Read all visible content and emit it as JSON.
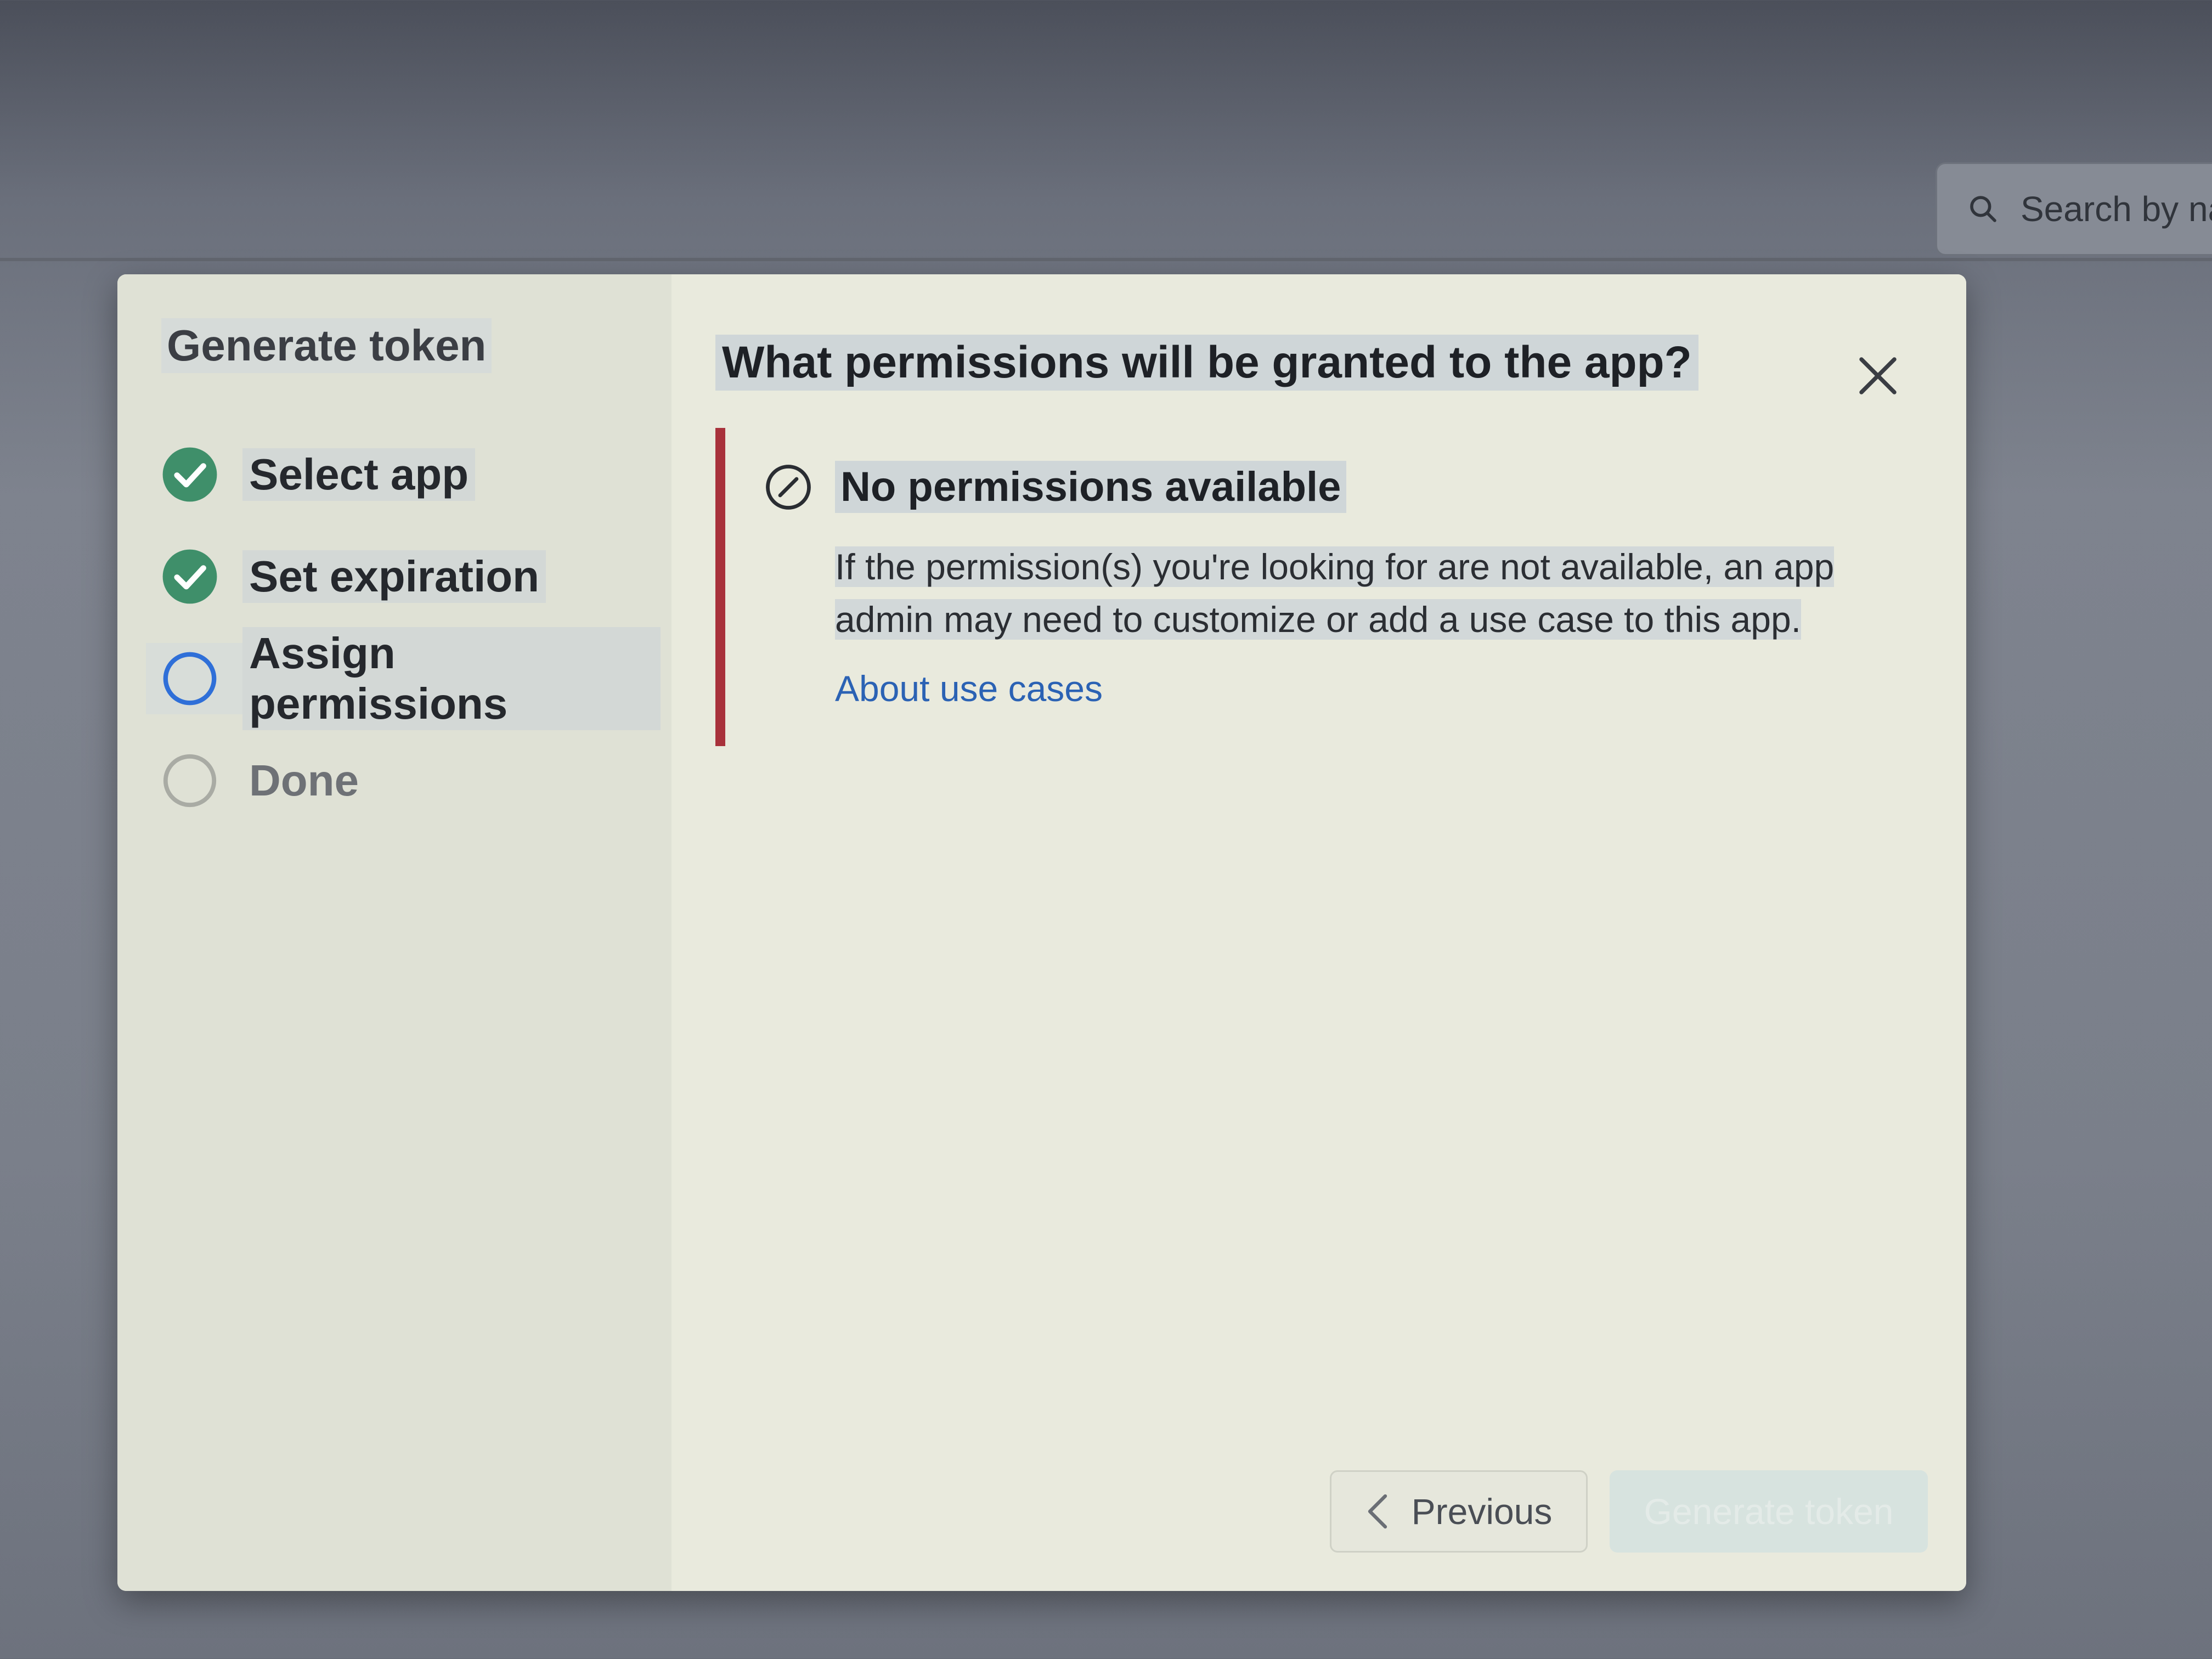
{
  "background": {
    "search_placeholder": "Search by na"
  },
  "modal": {
    "sidebar": {
      "title": "Generate token",
      "steps": [
        {
          "label": "Select app",
          "state": "complete"
        },
        {
          "label": "Set expiration",
          "state": "complete"
        },
        {
          "label": "Assign permissions",
          "state": "current"
        },
        {
          "label": "Done",
          "state": "pending"
        }
      ]
    },
    "main": {
      "title": "What permissions will be granted to the app?",
      "notice": {
        "heading": "No permissions available",
        "body": "If the permission(s) you're looking for are not available, an app admin may need to customize or add a use case to this app.",
        "link": "About use cases"
      },
      "footer": {
        "previous_label": "Previous",
        "next_label": "Generate token"
      }
    }
  },
  "colors": {
    "accent_error": "#a8323b",
    "check_green": "#3f8f6a",
    "current_blue": "#2f6fd8",
    "link_blue": "#2b62b4"
  }
}
